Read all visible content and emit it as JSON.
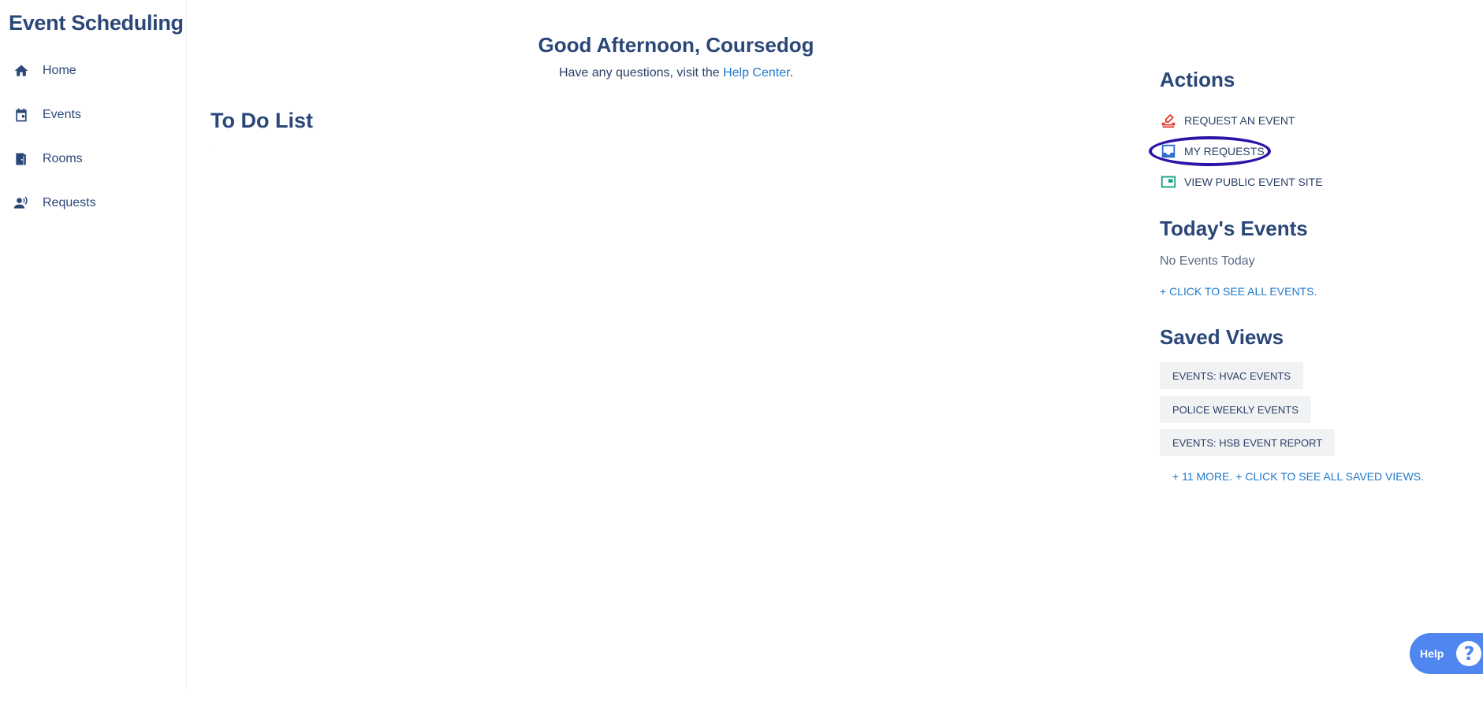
{
  "app": {
    "title": "Event Scheduling"
  },
  "sidebar": {
    "items": [
      {
        "label": "Home",
        "icon": "home-icon"
      },
      {
        "label": "Events",
        "icon": "calendar-icon"
      },
      {
        "label": "Rooms",
        "icon": "door-icon"
      },
      {
        "label": "Requests",
        "icon": "person-voice-icon"
      }
    ]
  },
  "main": {
    "greeting": "Good Afternoon, Coursedog",
    "subtext_prefix": "Have any questions, visit the ",
    "help_link": "Help Center",
    "subtext_suffix": ".",
    "todo_title": "To Do List"
  },
  "actions": {
    "title": "Actions",
    "items": [
      {
        "label": "REQUEST AN EVENT",
        "icon": "request-event-icon",
        "color": "#e03b2f"
      },
      {
        "label": "MY REQUESTS",
        "icon": "inbox-icon",
        "color": "#2f6fd0"
      },
      {
        "label": "VIEW PUBLIC EVENT SITE",
        "icon": "public-site-icon",
        "color": "#16a085"
      }
    ]
  },
  "todays_events": {
    "title": "Today's Events",
    "empty_text": "No Events Today",
    "see_all": "+ CLICK TO SEE ALL EVENTS."
  },
  "saved_views": {
    "title": "Saved Views",
    "items": [
      "EVENTS: HVAC EVENTS",
      "POLICE WEEKLY EVENTS",
      "EVENTS: HSB EVENT REPORT"
    ],
    "more_link": "+ 11 MORE. + CLICK TO SEE ALL SAVED VIEWS."
  },
  "help_widget": {
    "label": "Help",
    "glyph": "?"
  },
  "colors": {
    "primary_text": "#2a4778",
    "link": "#1f78c8",
    "help_bg": "#4f86f0",
    "highlight": "#2d14a8"
  }
}
